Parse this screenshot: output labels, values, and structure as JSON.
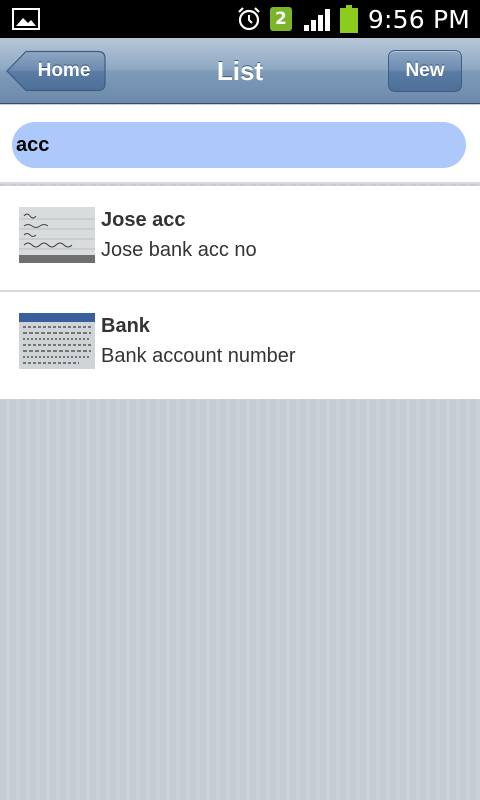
{
  "status_bar": {
    "time": "9:56 PM",
    "notification_count": "2",
    "icons": [
      "gallery-icon",
      "alarm-icon",
      "notification-badge",
      "signal-icon",
      "battery-icon"
    ],
    "colors": {
      "badge": "#7bb52a",
      "battery": "#8ccc1c"
    }
  },
  "navbar": {
    "title": "List",
    "home_label": "Home",
    "new_label": "New"
  },
  "search": {
    "value": "acc",
    "highlight_color": "#adc8fb"
  },
  "list": {
    "items": [
      {
        "title": "Jose acc",
        "subtitle": "Jose bank acc no",
        "thumbnail": "handwritten-note-thumbnail"
      },
      {
        "title": "Bank",
        "subtitle": "Bank account number",
        "thumbnail": "printed-document-thumbnail"
      }
    ]
  }
}
